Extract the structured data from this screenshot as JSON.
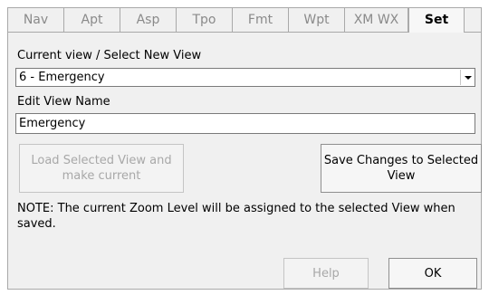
{
  "tabs": [
    {
      "label": "Nav"
    },
    {
      "label": "Apt"
    },
    {
      "label": "Asp"
    },
    {
      "label": "Tpo"
    },
    {
      "label": "Fmt"
    },
    {
      "label": "Wpt"
    },
    {
      "label": "XM WX"
    },
    {
      "label": "Set",
      "selected": true
    }
  ],
  "view_select": {
    "label": "Current view / Select New View",
    "value": "6 - Emergency"
  },
  "view_name": {
    "label": "Edit View Name",
    "value": "Emergency"
  },
  "buttons": {
    "load_view": "Load Selected View and make current",
    "save_changes": "Save Changes to Selected View",
    "help": "Help",
    "ok": "OK"
  },
  "note": "NOTE: The current Zoom Level will be assigned to the selected View when saved."
}
